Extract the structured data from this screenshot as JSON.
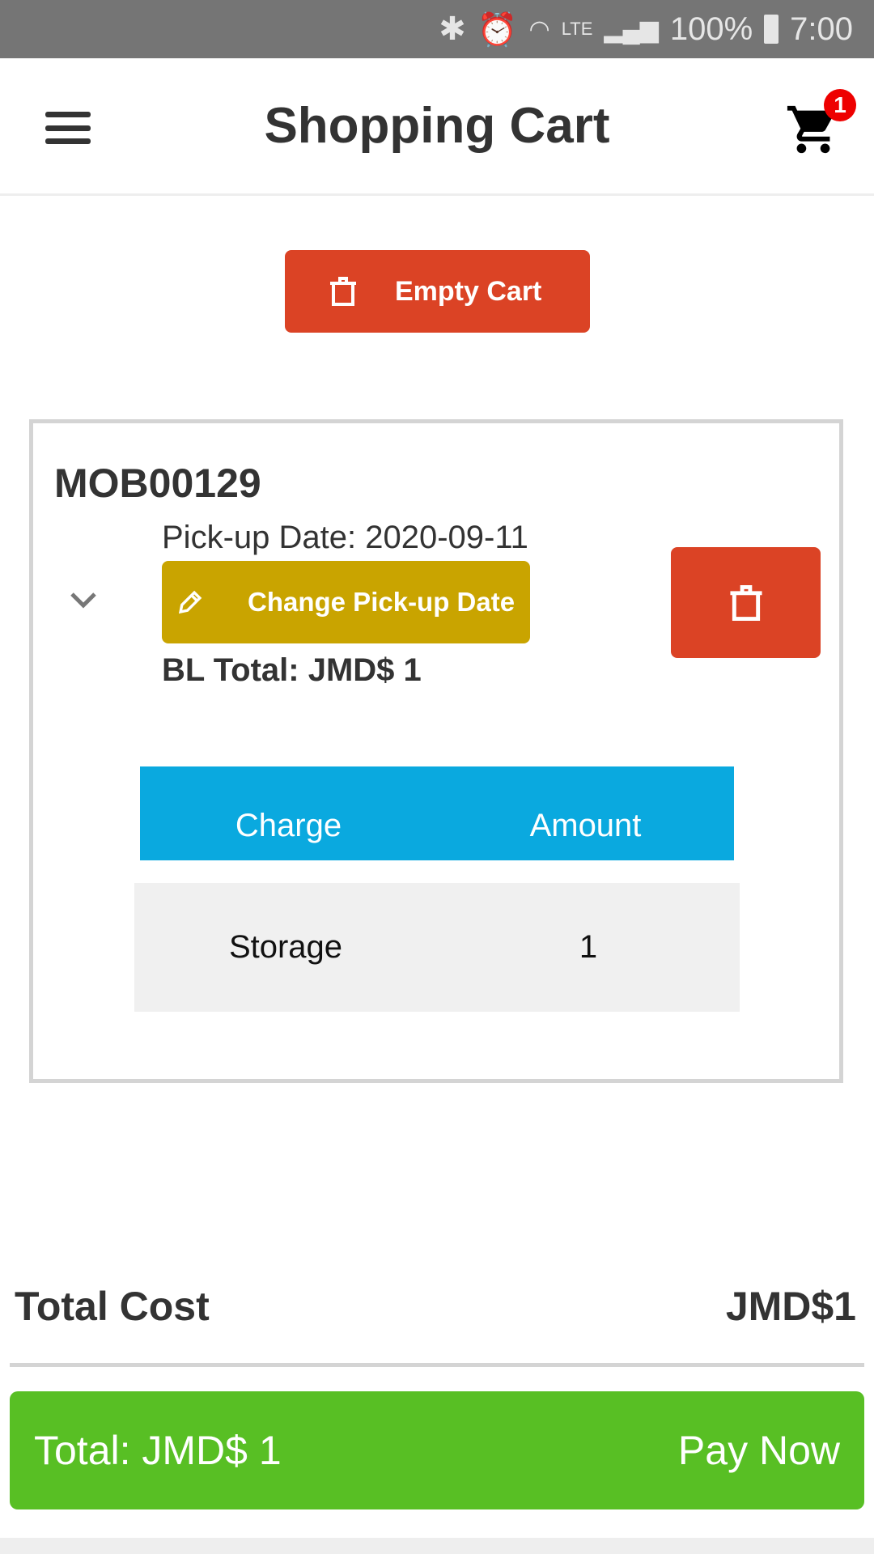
{
  "status_bar": {
    "battery": "100%",
    "time": "7:00",
    "network": "LTE"
  },
  "header": {
    "title": "Shopping Cart",
    "cart_count": "1"
  },
  "empty_cart_label": "Empty Cart",
  "item": {
    "id": "MOB00129",
    "pickup": "Pick-up Date: 2020-09-11",
    "change_label": "Change Pick-up Date",
    "bl_total": "BL Total: JMD$ 1",
    "table": {
      "headers": [
        "Charge",
        "Amount"
      ],
      "rows": [
        [
          "Storage",
          "1"
        ]
      ]
    }
  },
  "summary": {
    "label": "Total Cost",
    "value": "JMD$1"
  },
  "pay": {
    "total": "Total: JMD$ 1",
    "label": "Pay Now"
  },
  "colors": {
    "red": "#db4325",
    "gold": "#c9a400",
    "blue": "#0aa9df",
    "green": "#58bf24"
  }
}
